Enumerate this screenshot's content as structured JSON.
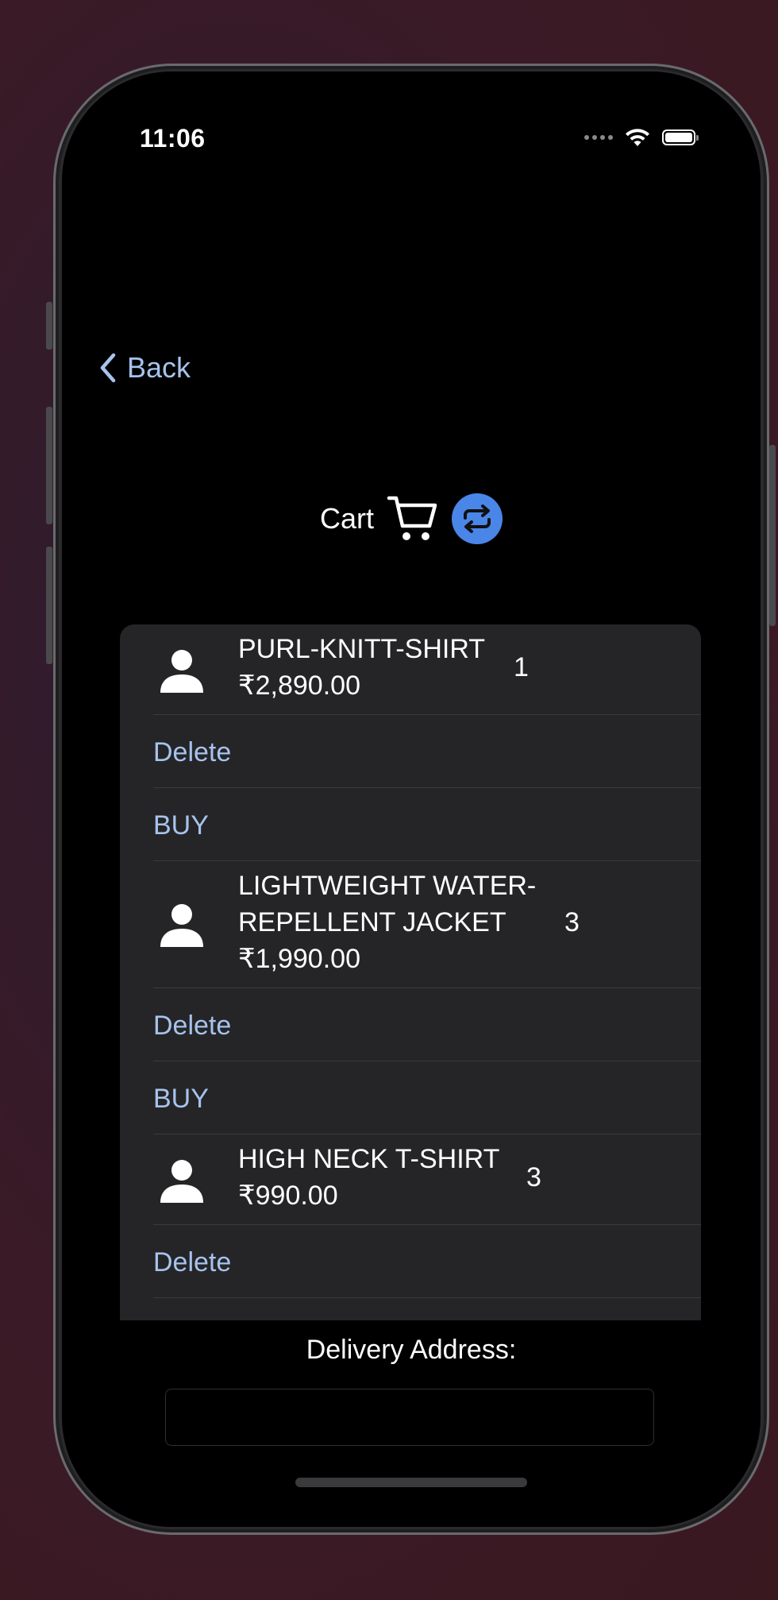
{
  "status_bar": {
    "time": "11:06"
  },
  "nav": {
    "back_label": "Back"
  },
  "header": {
    "title": "Cart",
    "cart_icon": "cart-icon",
    "refresh_icon": "repeat-icon"
  },
  "cart": {
    "items": [
      {
        "name_line1": "PURL-KNITT-SHIRT",
        "name_line2": "",
        "price": "₹2,890.00",
        "qty": "1"
      },
      {
        "name_line1": "LIGHTWEIGHT WATER-",
        "name_line2": "REPELLENT JACKET",
        "price": "₹1,990.00",
        "qty": "3"
      },
      {
        "name_line1": "HIGH NECK T-SHIRT",
        "name_line2": "",
        "price": "₹990.00",
        "qty": "3"
      }
    ],
    "delete_label": "Delete",
    "buy_label": "BUY"
  },
  "delivery": {
    "label": "Delivery Address:",
    "value": "",
    "placeholder": ""
  },
  "colors": {
    "accent": "#a6c3ec",
    "refresh_button": "#4a86e8",
    "list_background": "#252527",
    "screen_background": "#000000"
  }
}
